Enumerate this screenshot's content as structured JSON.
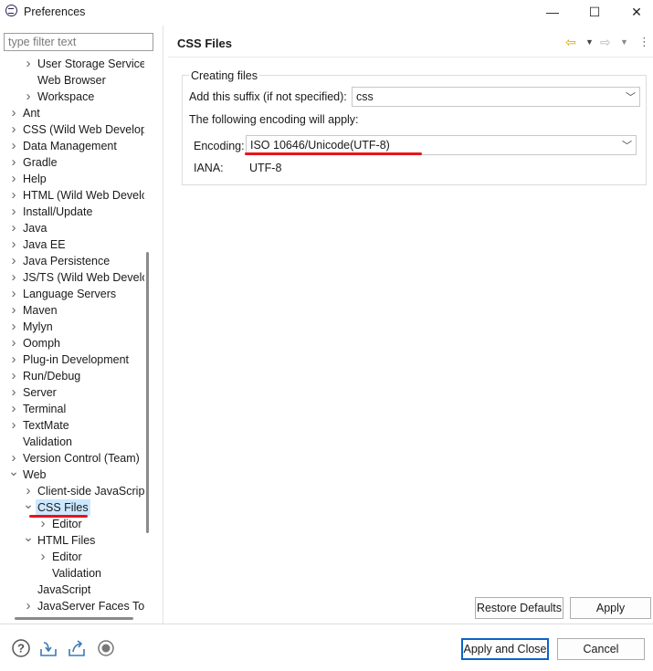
{
  "window": {
    "title": "Preferences",
    "minimize": "—",
    "maximize": "☐",
    "close": "✕"
  },
  "filter": {
    "placeholder": "type filter text"
  },
  "tree": [
    {
      "label": "User Storage Service",
      "level": 1,
      "twisty": "collapsed"
    },
    {
      "label": "Web Browser",
      "level": 1,
      "twisty": "none"
    },
    {
      "label": "Workspace",
      "level": 1,
      "twisty": "collapsed"
    },
    {
      "label": "Ant",
      "level": 0,
      "twisty": "collapsed"
    },
    {
      "label": "CSS (Wild Web Develop",
      "level": 0,
      "twisty": "collapsed"
    },
    {
      "label": "Data Management",
      "level": 0,
      "twisty": "collapsed"
    },
    {
      "label": "Gradle",
      "level": 0,
      "twisty": "collapsed"
    },
    {
      "label": "Help",
      "level": 0,
      "twisty": "collapsed"
    },
    {
      "label": "HTML (Wild Web Develc",
      "level": 0,
      "twisty": "collapsed"
    },
    {
      "label": "Install/Update",
      "level": 0,
      "twisty": "collapsed"
    },
    {
      "label": "Java",
      "level": 0,
      "twisty": "collapsed"
    },
    {
      "label": "Java EE",
      "level": 0,
      "twisty": "collapsed"
    },
    {
      "label": "Java Persistence",
      "level": 0,
      "twisty": "collapsed"
    },
    {
      "label": "JS/TS (Wild Web Develc",
      "level": 0,
      "twisty": "collapsed"
    },
    {
      "label": "Language Servers",
      "level": 0,
      "twisty": "collapsed"
    },
    {
      "label": "Maven",
      "level": 0,
      "twisty": "collapsed"
    },
    {
      "label": "Mylyn",
      "level": 0,
      "twisty": "collapsed"
    },
    {
      "label": "Oomph",
      "level": 0,
      "twisty": "collapsed"
    },
    {
      "label": "Plug-in Development",
      "level": 0,
      "twisty": "collapsed"
    },
    {
      "label": "Run/Debug",
      "level": 0,
      "twisty": "collapsed"
    },
    {
      "label": "Server",
      "level": 0,
      "twisty": "collapsed"
    },
    {
      "label": "Terminal",
      "level": 0,
      "twisty": "collapsed"
    },
    {
      "label": "TextMate",
      "level": 0,
      "twisty": "collapsed"
    },
    {
      "label": "Validation",
      "level": 0,
      "twisty": "none"
    },
    {
      "label": "Version Control (Team)",
      "level": 0,
      "twisty": "collapsed"
    },
    {
      "label": "Web",
      "level": 0,
      "twisty": "expanded"
    },
    {
      "label": "Client-side JavaScript",
      "level": 1,
      "twisty": "collapsed"
    },
    {
      "label": "CSS Files",
      "level": 1,
      "twisty": "expanded",
      "selected": true
    },
    {
      "label": "Editor",
      "level": 2,
      "twisty": "collapsed"
    },
    {
      "label": "HTML Files",
      "level": 1,
      "twisty": "expanded"
    },
    {
      "label": "Editor",
      "level": 2,
      "twisty": "collapsed"
    },
    {
      "label": "Validation",
      "level": 2,
      "twisty": "none"
    },
    {
      "label": "JavaScript",
      "level": 1,
      "twisty": "none"
    },
    {
      "label": "JavaServer Faces Too",
      "level": 1,
      "twisty": "collapsed"
    }
  ],
  "page": {
    "title": "CSS Files",
    "group_title": "Creating files",
    "suffix_label": "Add this suffix (if not specified):",
    "suffix_value": "css",
    "encoding_note": "The following encoding will apply:",
    "encoding_label": "Encoding:",
    "encoding_value": "ISO 10646/Unicode(UTF-8)",
    "iana_label": "IANA:",
    "iana_value": "UTF-8"
  },
  "buttons": {
    "restore_defaults": "Restore Defaults",
    "apply": "Apply",
    "apply_and_close": "Apply and Close",
    "cancel": "Cancel"
  },
  "colors": {
    "annotation_red": "#e8141c",
    "selection": "#cce8ff",
    "default_button": "#0a64c8"
  }
}
